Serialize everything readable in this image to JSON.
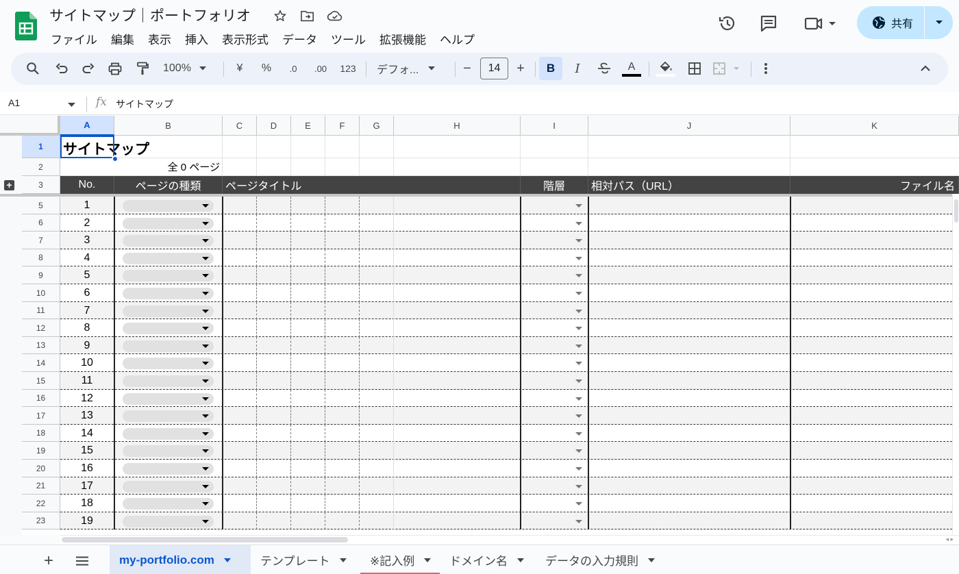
{
  "doc": {
    "title": "サイトマップ｜ポートフォリオ"
  },
  "menu": [
    "ファイル",
    "編集",
    "表示",
    "挿入",
    "表示形式",
    "データ",
    "ツール",
    "拡張機能",
    "ヘルプ"
  ],
  "share": {
    "label": "共有"
  },
  "toolbar": {
    "zoom": "100%",
    "currency": "¥",
    "percent": "%",
    "dec_decrease": ".0",
    "dec_increase": ".00",
    "number_format": "123",
    "font": "デフォ...",
    "font_size": "14",
    "minus": "−",
    "plus": "+",
    "bold": "B",
    "italic": "I",
    "text_color": "A"
  },
  "formula_bar": {
    "name_box": "A1",
    "fx": "fx",
    "content": "サイトマップ"
  },
  "columns": [
    "A",
    "B",
    "C",
    "D",
    "E",
    "F",
    "G",
    "H",
    "I",
    "J",
    "K"
  ],
  "rows_header": [
    "1",
    "2",
    "3"
  ],
  "cells": {
    "title": "サイトマップ",
    "total": "全 0 ページ"
  },
  "table_header": {
    "no": "No.",
    "page_type": "ページの種類",
    "page_title": "ページタイトル",
    "level": "階層",
    "relative_path": "相対パス（URL）",
    "file_name": "ファイル名"
  },
  "data_rows": [
    {
      "row": "5",
      "no": "1"
    },
    {
      "row": "6",
      "no": "2"
    },
    {
      "row": "7",
      "no": "3"
    },
    {
      "row": "8",
      "no": "4"
    },
    {
      "row": "9",
      "no": "5"
    },
    {
      "row": "10",
      "no": "6"
    },
    {
      "row": "11",
      "no": "7"
    },
    {
      "row": "12",
      "no": "8"
    },
    {
      "row": "13",
      "no": "9"
    },
    {
      "row": "14",
      "no": "10"
    },
    {
      "row": "15",
      "no": "11"
    },
    {
      "row": "16",
      "no": "12"
    },
    {
      "row": "17",
      "no": "13"
    },
    {
      "row": "18",
      "no": "14"
    },
    {
      "row": "19",
      "no": "15"
    },
    {
      "row": "20",
      "no": "16"
    },
    {
      "row": "21",
      "no": "17"
    },
    {
      "row": "22",
      "no": "18"
    },
    {
      "row": "23",
      "no": "19"
    }
  ],
  "sheet_tabs": [
    {
      "label": "my-portfolio.com",
      "active": true
    },
    {
      "label": "テンプレート",
      "active": false
    },
    {
      "label": "※記入例",
      "active": false,
      "color": "#e06666"
    },
    {
      "label": "ドメイン名",
      "active": false
    },
    {
      "label": "データの入力規則",
      "active": false
    }
  ],
  "colors": {
    "accent": "#0b57d0",
    "share_bg": "#c2e7ff",
    "header_row_bg": "#434343",
    "sheets_green": "#0f9d58"
  }
}
